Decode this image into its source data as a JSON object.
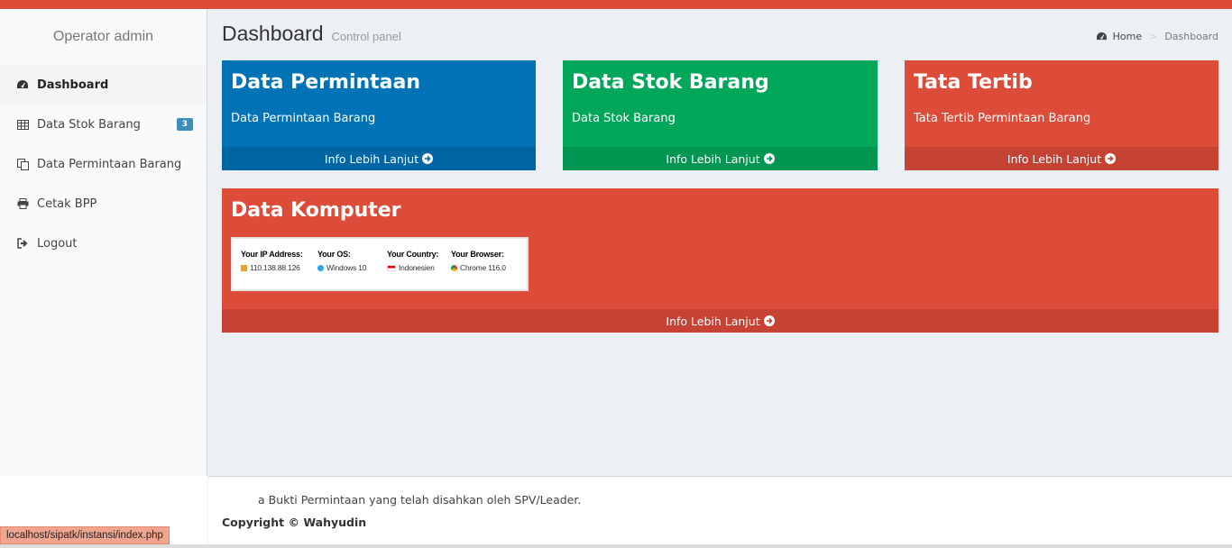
{
  "sidebar": {
    "user": "Operator admin",
    "items": [
      {
        "label": "Dashboard",
        "icon": "dashboard-icon"
      },
      {
        "label": "Data Stok Barang",
        "icon": "table-icon",
        "badge": "3"
      },
      {
        "label": "Data Permintaan Barang",
        "icon": "copy-icon"
      },
      {
        "label": "Cetak BPP",
        "icon": "print-icon"
      },
      {
        "label": "Logout",
        "icon": "sign-out-icon"
      }
    ]
  },
  "header": {
    "title": "Dashboard",
    "subtitle": "Control panel",
    "breadcrumb": {
      "home": "Home",
      "current": "Dashboard"
    }
  },
  "boxes": [
    {
      "title": "Data Permintaan",
      "desc": "Data Permintaan Barang",
      "link": "Info Lebih Lanjut",
      "color": "#0073b7"
    },
    {
      "title": "Data Stok Barang",
      "desc": "Data Stok Barang",
      "link": "Info Lebih Lanjut",
      "color": "#00a65a"
    },
    {
      "title": "Tata Tertib",
      "desc": "Tata Tertib Permintaan Barang",
      "link": "Info Lebih Lanjut",
      "color": "#dd4b39"
    }
  ],
  "computer": {
    "title": "Data Komputer",
    "link": "Info Lebih Lanjut",
    "color": "#dd4b39",
    "widget": [
      {
        "label": "Your IP Address:",
        "value": "110.138.88.126"
      },
      {
        "label": "Your OS:",
        "value": "Windows 10"
      },
      {
        "label": "Your Country:",
        "value": "Indonesien"
      },
      {
        "label": "Your Browser:",
        "value": "Chrome 116.0"
      }
    ]
  },
  "footer": {
    "note": "a Bukti Permintaan yang telah disahkan oleh SPV/Leader.",
    "copyright": "Copyright © Wahyudin"
  },
  "status_url": "localhost/sipatk/instansi/index.php"
}
